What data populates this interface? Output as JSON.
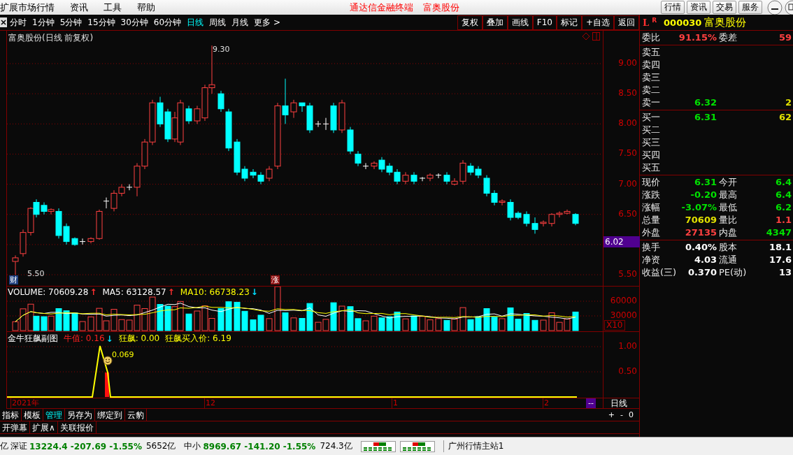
{
  "menu_bar": {
    "items": [
      "扩展市场行情",
      "资讯",
      "工具",
      "帮助"
    ],
    "app_title": "通达信金融终端",
    "stock_title": "富奥股份",
    "right_buttons": [
      "行情",
      "资讯",
      "交易",
      "服务"
    ]
  },
  "period_tabs": [
    {
      "label": "分时",
      "selected": false
    },
    {
      "label": "1分钟",
      "selected": false
    },
    {
      "label": "5分钟",
      "selected": false
    },
    {
      "label": "15分钟",
      "selected": false
    },
    {
      "label": "30分钟",
      "selected": false
    },
    {
      "label": "60分钟",
      "selected": false
    },
    {
      "label": "日线",
      "selected": true
    },
    {
      "label": "周线",
      "selected": false
    },
    {
      "label": "月线",
      "selected": false
    },
    {
      "label": "更多 >",
      "selected": false
    }
  ],
  "chart_toolbar": [
    "复权",
    "叠加",
    "画线",
    "F10",
    "标记",
    "+自选",
    "返回"
  ],
  "price_pane": {
    "title": "富奥股份(日线 前复权)",
    "annotations": [
      {
        "text": "9.30",
        "kind": "high"
      },
      {
        "text": "5.50",
        "kind": "low"
      }
    ],
    "markers": [
      {
        "text": "财",
        "kind": "finance"
      },
      {
        "text": "涨",
        "kind": "limit"
      }
    ],
    "axis": [
      "9.00",
      "8.50",
      "8.00",
      "7.50",
      "7.00",
      "6.50",
      "5.50"
    ],
    "current_price": "6.02"
  },
  "volume_pane": {
    "legend": [
      {
        "text": "VOLUME: 70609.28",
        "kind": "rising",
        "arrow": "↑"
      },
      {
        "text": "MA5: 63128.57",
        "kind": "rising",
        "arrow": "↑"
      },
      {
        "text": "MA10: 66738.23",
        "color": "#ffff00",
        "kind": "falling",
        "arrow": "↓"
      }
    ],
    "axis": [
      "60000",
      "30000"
    ],
    "scale": "X10"
  },
  "indicator_pane": {
    "legend": [
      {
        "text": "金牛狂飙副图"
      },
      {
        "text": "牛值: 0.16",
        "color": "#ff2020",
        "kind": "falling",
        "arrow": "↓"
      },
      {
        "text": "狂飙: 0.00",
        "color": "#ffff00"
      },
      {
        "text": "狂飙买入价: 6.19",
        "color": "#ffff00"
      }
    ],
    "annotation": "0.069",
    "axis": [
      "1.00",
      "0.50"
    ]
  },
  "date_axis": {
    "labels": [
      "2021年",
      "12",
      "1",
      "2"
    ],
    "cursor": "--",
    "period": "日线"
  },
  "bottom_tabs": [
    {
      "label": "指标",
      "selected": false
    },
    {
      "label": "模板",
      "selected": false
    },
    {
      "label": "管理",
      "selected": true
    },
    {
      "label": "另存为",
      "selected": false
    },
    {
      "label": "绑定到",
      "selected": false
    },
    {
      "label": "云豹",
      "selected": false
    }
  ],
  "zoom_controls": [
    "+",
    "-",
    "0"
  ],
  "bottom_buttons": [
    "开弹幕",
    "扩展∧",
    "关联报价"
  ],
  "quote_panel": {
    "flag_l": "L",
    "flag_r": "R",
    "code": "000030",
    "name": "富奥股份",
    "order_ratio": {
      "label": "委比",
      "value": "91.15%",
      "label2": "委差",
      "value2": "59"
    },
    "sell": [
      {
        "label": "卖五"
      },
      {
        "label": "卖四"
      },
      {
        "label": "卖三"
      },
      {
        "label": "卖二"
      },
      {
        "label": "卖一",
        "price": "6.32",
        "volume": "2"
      }
    ],
    "buy": [
      {
        "label": "买一",
        "price": "6.31",
        "volume": "62"
      },
      {
        "label": "买二"
      },
      {
        "label": "买三"
      },
      {
        "label": "买四"
      },
      {
        "label": "买五"
      }
    ],
    "stats": [
      {
        "left": {
          "label": "现价",
          "value": "6.31",
          "color": "#00e000"
        },
        "right": {
          "label": "今开",
          "value": "6.4",
          "color": "#00e000"
        }
      },
      {
        "left": {
          "label": "涨跌",
          "value": "-0.20",
          "color": "#00e000"
        },
        "right": {
          "label": "最高",
          "value": "6.4",
          "color": "#00e000"
        }
      },
      {
        "left": {
          "label": "涨幅",
          "value": "-3.07%",
          "color": "#00e000"
        },
        "right": {
          "label": "最低",
          "value": "6.2",
          "color": "#00e000"
        }
      },
      {
        "left": {
          "label": "总量",
          "value": "70609",
          "color": "#e0e000"
        },
        "right": {
          "label": "量比",
          "value": "1.1",
          "color": "#ff4040"
        }
      },
      {
        "left": {
          "label": "外盘",
          "value": "27135",
          "color": "#ff4040"
        },
        "right": {
          "label": "内盘",
          "value": "4347",
          "color": "#00e000"
        }
      }
    ],
    "finance": [
      {
        "label": "换手",
        "value": "0.40%",
        "label2": "股本",
        "value2": "18.1"
      },
      {
        "label": "净资",
        "value": "4.03",
        "label2": "流通",
        "value2": "17.6"
      },
      {
        "label": "收益(三)",
        "value": "0.370",
        "label2": "PE(动)",
        "value2": "13"
      }
    ]
  },
  "status_bar": {
    "lead": "亿",
    "indices": [
      {
        "name": "深证",
        "quote": "13224.4 -207.69 -1.55%",
        "amount": "5652亿"
      },
      {
        "name": "中小",
        "quote": "8969.67 -141.20 -1.55%",
        "amount": "724.3亿"
      }
    ],
    "server": "广州行情主站1"
  }
}
